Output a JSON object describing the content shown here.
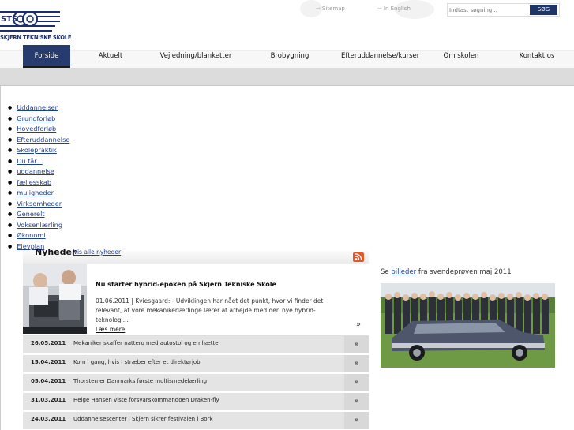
{
  "header": {
    "logo_text": "STS",
    "school_name": "SKJERN TEKNISKE SKOLE",
    "sitemap": "Sitemap",
    "english": "In English",
    "search_placeholder": "Indtast søgning...",
    "search_button": "SØG"
  },
  "nav": [
    {
      "label": "Forside",
      "active": true
    },
    {
      "label": "Aktuelt"
    },
    {
      "label": "Vejledning/blanketter"
    },
    {
      "label": "Brobygning"
    },
    {
      "label": "Efteruddannelse/kurser"
    },
    {
      "label": "Om skolen"
    },
    {
      "label": "Kontakt os"
    }
  ],
  "sidemenu": [
    "Uddannelser",
    "Grundforløb",
    "Hovedforløb",
    "Efteruddannelse",
    "Skolepraktik",
    "Du får...",
    "uddannelse",
    "fællesskab",
    "muligheder",
    "Virksomheder",
    "Generelt",
    "Voksenlærling",
    "Økonomi",
    "Elevplan"
  ],
  "news": {
    "title": "Nyheder",
    "see_all": "Vis alle nyheder",
    "featured": {
      "title": "Nu starter hybrid-epoken på Skjern Tekniske Skole",
      "body": "01.06.2011 | Kviesgaard: - Udviklingen har nået det punkt, hvor vi finder det relevant, at vore mekanikerlærlinge lærer at arbejde med den nye hybrid-teknologi...",
      "more": "Læs mere"
    },
    "items": [
      {
        "date": "26.05.2011",
        "headline": "Mekaniker skaffer nattero med autostol og emhætte"
      },
      {
        "date": "15.04.2011",
        "headline": "Kom i gang, hvis I stræber efter et direktørjob"
      },
      {
        "date": "05.04.2011",
        "headline": "Thorsten er Danmarks første multismedelærling"
      },
      {
        "date": "31.03.2011",
        "headline": "Helge Hansen viste forsvarskommandoen Draken-fly"
      },
      {
        "date": "24.03.2011",
        "headline": "Uddannelsescenter i Skjern sikrer festivalen i Bork"
      }
    ]
  },
  "aside": {
    "caption_pre": "Se",
    "caption_link": "billeder",
    "caption_post": "fra svendeprøven maj 2011"
  },
  "colors": {
    "nav_active": "#273b6f",
    "link": "#1f3f8f",
    "search_button": "#1f3565"
  }
}
